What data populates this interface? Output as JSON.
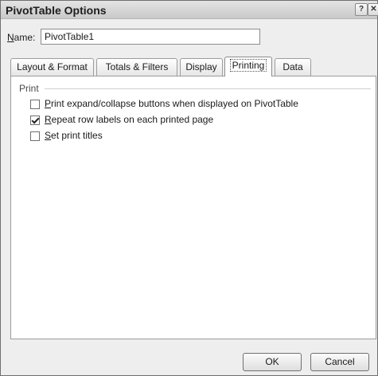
{
  "window": {
    "title": "PivotTable Options",
    "help_glyph": "?",
    "close_glyph": "✕"
  },
  "name_field": {
    "label_accel": "N",
    "label_rest": "ame:",
    "value": "PivotTable1"
  },
  "tabs": [
    {
      "label": "Layout & Format",
      "active": false
    },
    {
      "label": "Totals & Filters",
      "active": false
    },
    {
      "label": "Display",
      "active": false
    },
    {
      "label": "Printing",
      "active": true
    },
    {
      "label": "Data",
      "active": false
    }
  ],
  "print_group": {
    "label": "Print",
    "options": [
      {
        "accel": "P",
        "rest": "rint expand/collapse buttons when displayed on PivotTable",
        "checked": false
      },
      {
        "accel": "R",
        "rest": "epeat row labels on each printed page",
        "checked": true
      },
      {
        "accel": "S",
        "rest": "et print titles",
        "checked": false
      }
    ]
  },
  "buttons": {
    "ok": "OK",
    "cancel": "Cancel"
  }
}
